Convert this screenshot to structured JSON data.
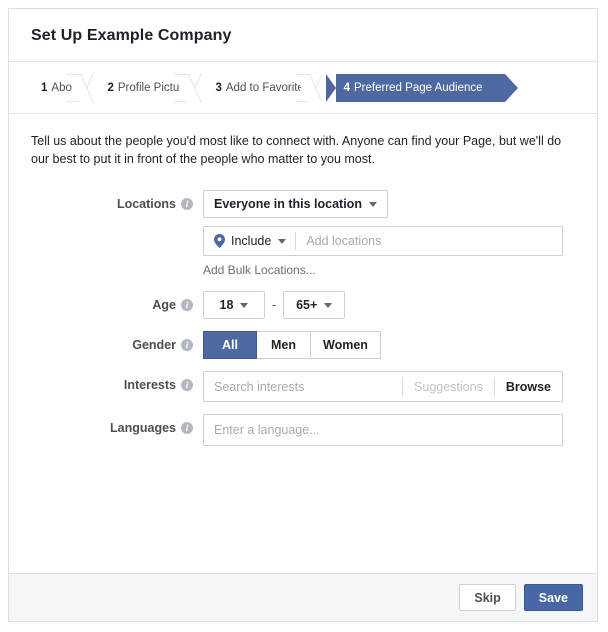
{
  "header": {
    "title": "Set Up Example Company"
  },
  "steps": [
    {
      "num": "1",
      "label": "About",
      "active": false
    },
    {
      "num": "2",
      "label": "Profile Picture",
      "active": false
    },
    {
      "num": "3",
      "label": "Add to Favorites",
      "active": false
    },
    {
      "num": "4",
      "label": "Preferred Page Audience",
      "active": true
    }
  ],
  "intro": "Tell us about the people you'd most like to connect with. Anyone can find your Page, but we'll do our best to put it in front of the people who matter to you most.",
  "form": {
    "locations": {
      "label": "Locations",
      "info_icon": "info-icon",
      "scope_value": "Everyone in this location",
      "include_label": "Include",
      "pin_icon": "map-pin-icon",
      "locations_placeholder": "Add locations",
      "locations_value": "",
      "bulk_link": "Add Bulk Locations..."
    },
    "age": {
      "label": "Age",
      "min_value": "18",
      "max_value": "65+",
      "separator": "-"
    },
    "gender": {
      "label": "Gender",
      "options": [
        "All",
        "Men",
        "Women"
      ],
      "selected": "All"
    },
    "interests": {
      "label": "Interests",
      "placeholder": "Search interests",
      "value": "",
      "suggestions_label": "Suggestions",
      "browse_label": "Browse"
    },
    "languages": {
      "label": "Languages",
      "placeholder": "Enter a language...",
      "value": ""
    }
  },
  "footer": {
    "skip_label": "Skip",
    "save_label": "Save"
  },
  "colors": {
    "accent_blue": "#4e69a2",
    "primary_button": "#4967a5",
    "border": "#ccd0d5",
    "text": "#1d2129",
    "muted_text": "#bec3c9"
  }
}
